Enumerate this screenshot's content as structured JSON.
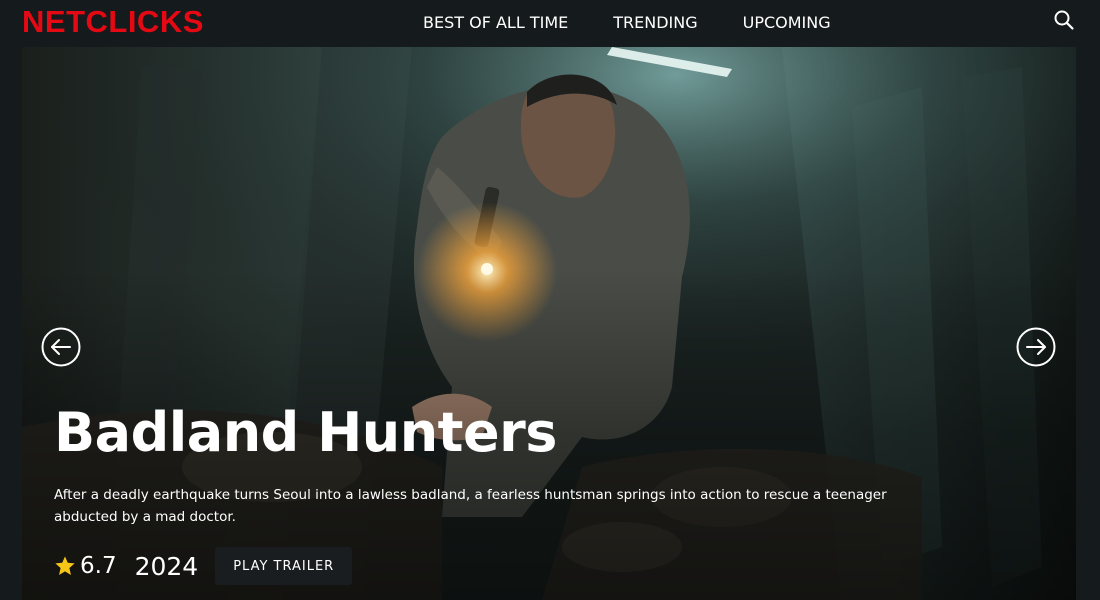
{
  "brand": {
    "name": "NETCLICKS",
    "color": "#e50914"
  },
  "nav": {
    "items": [
      "BEST OF ALL TIME",
      "TRENDING",
      "UPCOMING"
    ]
  },
  "icons": {
    "search": "search-icon",
    "prev": "arrow-left-icon",
    "next": "arrow-right-icon",
    "rating": "star-icon"
  },
  "hero": {
    "title": "Badland Hunters",
    "description": "After a deadly earthquake turns Seoul into a lawless badland, a fearless huntsman springs into action to rescue a teenager abducted by a mad doctor.",
    "rating": "6.7",
    "year": "2024",
    "play_label": "PLAY TRAILER",
    "star_color": "#f5c518"
  }
}
